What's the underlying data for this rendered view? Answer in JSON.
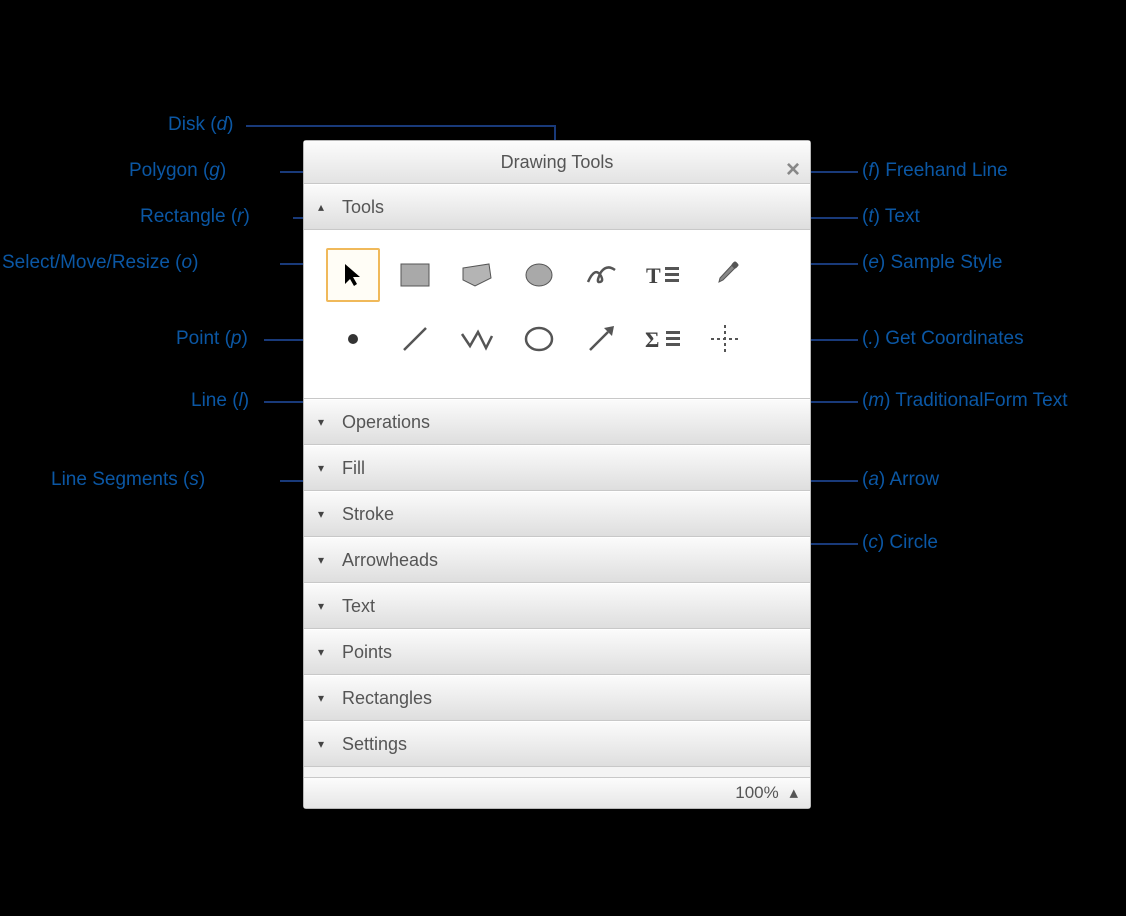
{
  "panel": {
    "title": "Drawing Tools",
    "zoom": "100%",
    "sections": {
      "tools": "Tools",
      "operations": "Operations",
      "fill": "Fill",
      "stroke": "Stroke",
      "arrowheads": "Arrowheads",
      "text": "Text",
      "points": "Points",
      "rectangles": "Rectangles",
      "settings": "Settings"
    }
  },
  "callouts_left": {
    "disk": "Disk (d)",
    "polygon": "Polygon (g)",
    "rectangle": "Rectangle (r )",
    "select": "Select/Move/Resize (o)",
    "point": "Point (p)",
    "line": "Line (l)",
    "segments": "Line Segments (s)"
  },
  "callouts_right": {
    "freehand": "(f) Freehand Line",
    "text": "(t) Text",
    "sample": "(e) Sample Style",
    "getcoord": "(.) Get Coordinates",
    "tradform": "(m) TraditionalForm Text",
    "arrow": "(a) Arrow",
    "circle": "(c) Circle"
  },
  "tools": [
    {
      "id": "select",
      "label": "Select/Move/Resize",
      "shortcut": "o"
    },
    {
      "id": "rectangle",
      "label": "Rectangle",
      "shortcut": "r"
    },
    {
      "id": "polygon",
      "label": "Polygon",
      "shortcut": "g"
    },
    {
      "id": "disk",
      "label": "Disk",
      "shortcut": "d"
    },
    {
      "id": "freehand",
      "label": "Freehand Line",
      "shortcut": "f"
    },
    {
      "id": "texttool",
      "label": "Text",
      "shortcut": "t"
    },
    {
      "id": "sample",
      "label": "Sample Style",
      "shortcut": "e"
    },
    {
      "id": "point",
      "label": "Point",
      "shortcut": "p"
    },
    {
      "id": "line",
      "label": "Line",
      "shortcut": "l"
    },
    {
      "id": "segments",
      "label": "Line Segments",
      "shortcut": "s"
    },
    {
      "id": "circle",
      "label": "Circle",
      "shortcut": "c"
    },
    {
      "id": "arrow",
      "label": "Arrow",
      "shortcut": "a"
    },
    {
      "id": "tradform",
      "label": "TraditionalForm Text",
      "shortcut": "m"
    },
    {
      "id": "getcoord",
      "label": "Get Coordinates",
      "shortcut": "."
    }
  ]
}
